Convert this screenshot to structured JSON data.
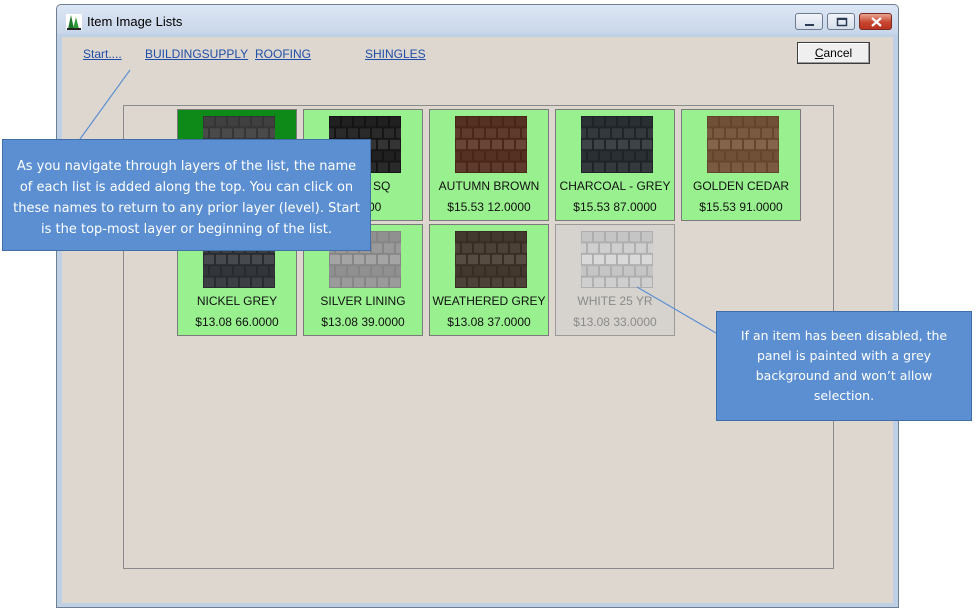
{
  "window": {
    "title": "Item Image Lists"
  },
  "breadcrumbs": [
    "Start....",
    "BUILDINGSUPPLY",
    "ROOFING",
    "SHINGLES"
  ],
  "cancel": {
    "label_first": "C",
    "label_rest": "ancel"
  },
  "items": [
    {
      "name": "",
      "price": "",
      "state": "selected",
      "swatch": "#4a4a4a"
    },
    {
      "name": "er 216 SQ",
      "price": "9.0000",
      "state": "normal",
      "swatch": "#2a2a2a"
    },
    {
      "name": "AUTUMN BROWN",
      "price": "$15.53  12.0000",
      "state": "normal",
      "swatch": "#5e3b2c"
    },
    {
      "name": "CHARCOAL - GREY",
      "price": "$15.53  87.0000",
      "state": "normal",
      "swatch": "#33393d"
    },
    {
      "name": "GOLDEN CEDAR",
      "price": "$15.53  91.0000",
      "state": "normal",
      "swatch": "#7a5a40"
    },
    {
      "name": "NICKEL GREY",
      "price": "$13.08  66.0000",
      "state": "normal",
      "swatch": "#3c4045"
    },
    {
      "name": "SILVER LINING",
      "price": "$13.08  39.0000",
      "state": "normal",
      "swatch": "#9a9a9a"
    },
    {
      "name": "WEATHERED GREY",
      "price": "$13.08  37.0000",
      "state": "normal",
      "swatch": "#4d4238"
    },
    {
      "name": "WHITE 25 YR",
      "price": "$13.08  33.0000",
      "state": "disabled",
      "swatch": "#cfcfcf"
    }
  ],
  "callouts": {
    "navigation": "As you navigate through layers of the list, the name of each list is added along the top. You can click on these names to return to any prior layer (level).  Start is the top-most layer or beginning of the list.",
    "disabled": "If an item has been disabled, the panel is painted with a grey background and won’t allow selection."
  }
}
